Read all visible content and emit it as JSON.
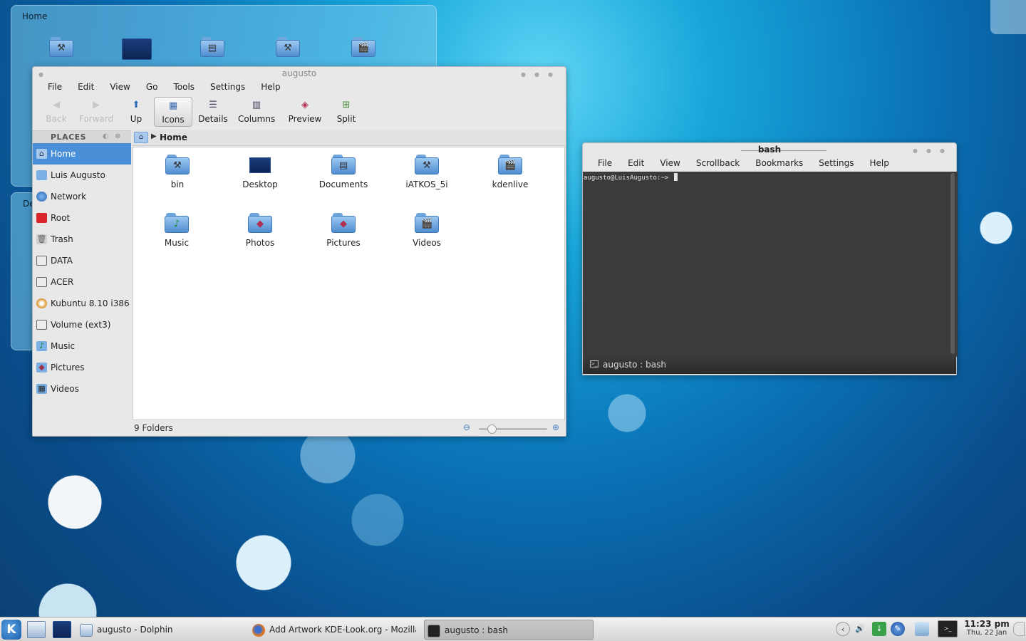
{
  "desktop": {
    "folderview_title": "Home",
    "folderview2_label": "De"
  },
  "dolphin": {
    "title": "augusto",
    "menu": [
      "File",
      "Edit",
      "View",
      "Go",
      "Tools",
      "Settings",
      "Help"
    ],
    "toolbar": {
      "back": "Back",
      "forward": "Forward",
      "up": "Up",
      "icons": "Icons",
      "details": "Details",
      "columns": "Columns",
      "preview": "Preview",
      "split": "Split"
    },
    "places_header": "PLACES",
    "places": [
      {
        "label": "Home",
        "icon": "home-icon",
        "selected": true
      },
      {
        "label": "Luis Augusto",
        "icon": "folder-icon"
      },
      {
        "label": "Network",
        "icon": "network-icon"
      },
      {
        "label": "Root",
        "icon": "root-folder-icon"
      },
      {
        "label": "Trash",
        "icon": "trash-icon"
      },
      {
        "label": "DATA",
        "icon": "drive-icon"
      },
      {
        "label": "ACER",
        "icon": "drive-icon"
      },
      {
        "label": "Kubuntu 8.10 i386",
        "icon": "cdrom-icon"
      },
      {
        "label": "Volume (ext3)",
        "icon": "drive-icon"
      },
      {
        "label": "Music",
        "icon": "music-folder-icon"
      },
      {
        "label": "Pictures",
        "icon": "pictures-folder-icon"
      },
      {
        "label": "Videos",
        "icon": "videos-folder-icon"
      }
    ],
    "breadcrumb": "Home",
    "items": [
      {
        "name": "bin",
        "icon": "tools-folder-icon"
      },
      {
        "name": "Desktop",
        "icon": "desktop-folder-icon"
      },
      {
        "name": "Documents",
        "icon": "documents-folder-icon"
      },
      {
        "name": "iATKOS_5i",
        "icon": "tools-folder-icon"
      },
      {
        "name": "kdenlive",
        "icon": "video-folder-icon"
      },
      {
        "name": "Music",
        "icon": "music-folder-icon"
      },
      {
        "name": "Photos",
        "icon": "photos-folder-icon"
      },
      {
        "name": "Pictures",
        "icon": "pictures-folder-icon"
      },
      {
        "name": "Videos",
        "icon": "video-folder-icon"
      }
    ],
    "status": "9 Folders",
    "zoom_level": 0.15
  },
  "konsole": {
    "title": "bash",
    "menu": [
      "File",
      "Edit",
      "View",
      "Scrollback",
      "Bookmarks",
      "Settings",
      "Help"
    ],
    "prompt": "augusto@LuisAugusto:~>",
    "tab_label": "augusto : bash"
  },
  "taskbar": {
    "tasks": [
      {
        "label": "augusto - Dolphin",
        "icon": "dolphin-icon"
      },
      {
        "label": "Add Artwork KDE-Look.org - Mozilla F",
        "icon": "firefox-icon"
      },
      {
        "label": "augusto : bash",
        "icon": "terminal-icon",
        "active": true
      }
    ],
    "clock_time": "11:23 pm",
    "clock_date": "Thu, 22 Jan"
  },
  "colors": {
    "selection": "#4a90d9",
    "terminal_bg": "#3b3b3b",
    "folder_blue": "#6fa6de"
  }
}
